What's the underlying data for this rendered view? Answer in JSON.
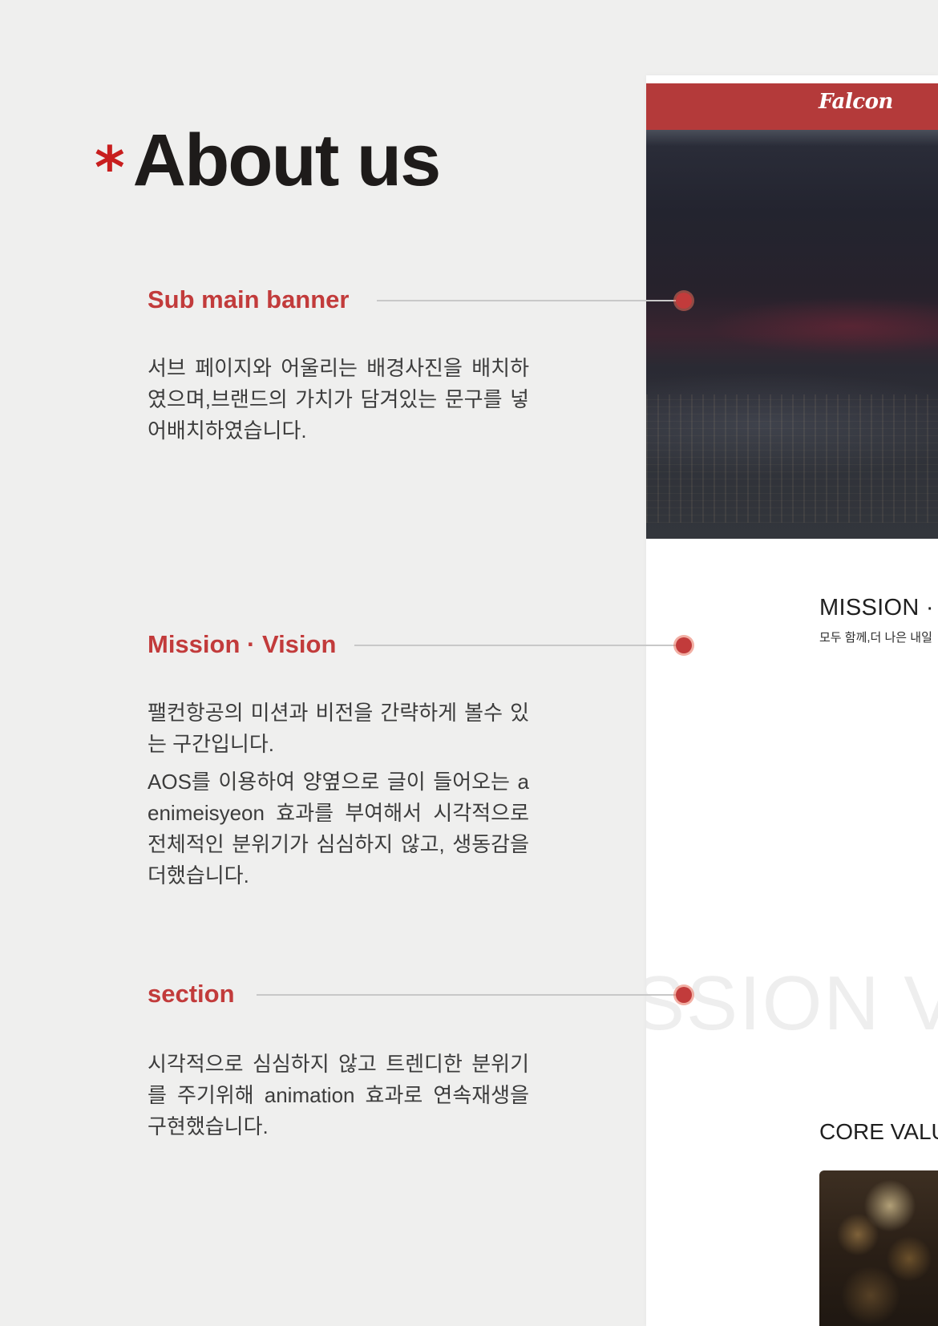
{
  "page": {
    "title_mark": "*",
    "title": "About us"
  },
  "sections": [
    {
      "label": "Sub main banner",
      "paragraphs": [
        "서브 페이지와 어울리는 배경사진을 배치하였으며,브랜드의 가치가 담겨있는 문구를 넣어배치하였습니다."
      ]
    },
    {
      "label": "Mission · Vision",
      "paragraphs": [
        "팰컨항공의 미션과 비전을 간략하게 볼수 있는 구간입니다.",
        "AOS를 이용하여 양옆으로 글이 들어오는 aenimeisyeon 효과를 부여해서 시각적으로 전체적인 분위기가 심심하지 않고, 생동감을 더했습니다."
      ]
    },
    {
      "label": "section",
      "paragraphs": [
        "시각적으로 심심하지 않고 트렌디한 분위기를 주기위해 animation 효과로 연속재생을 구현했습니다."
      ]
    }
  ],
  "preview": {
    "logo": "Falcon",
    "mission_title": "MISSION · V",
    "mission_subtitle": "모두 함께,더 나은 내일",
    "watermark": "SSION VIS",
    "core_title": "CORE VALU"
  },
  "colors": {
    "accent": "#c23b3b",
    "title_star": "#c81e1e",
    "header_bar": "#b43a3a",
    "background": "#efefee"
  },
  "icons": {
    "connector_dot": "circle-marker-icon"
  }
}
